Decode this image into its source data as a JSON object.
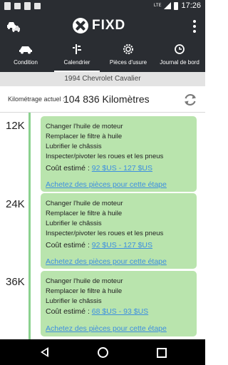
{
  "status_bar": {
    "network": "LTE",
    "time": "17:26"
  },
  "app": {
    "name": "FIXD"
  },
  "tabs": [
    {
      "label": "Condition",
      "icon": "car-icon"
    },
    {
      "label": "Calendrier",
      "icon": "wrench-icon"
    },
    {
      "label": "Pièces d'usure",
      "icon": "gear-icon"
    },
    {
      "label": "Journal de bord",
      "icon": "history-icon"
    }
  ],
  "vehicle": {
    "name": "1994 Chevrolet Cavalier"
  },
  "mileage": {
    "label": "Kilométrage actuel :",
    "value": "104 836 Kilomètres"
  },
  "schedule": [
    {
      "mileage": "12K",
      "tasks": [
        "Changer l'huile de moteur",
        "Remplacer le filtre à huile",
        "Lubrifier le châssis",
        "Inspecter/pivoter les roues et les pneus"
      ],
      "cost_label": "Coût estimé :",
      "cost": "92 $US - 127 $US",
      "parts_link": "Achetez des pièces pour cette étape"
    },
    {
      "mileage": "24K",
      "tasks": [
        "Changer l'huile de moteur",
        "Remplacer le filtre à huile",
        "Lubrifier le châssis",
        "Inspecter/pivoter les roues et les pneus"
      ],
      "cost_label": "Coût estimé :",
      "cost": "92 $US - 127 $US",
      "parts_link": "Achetez des pièces pour cette étape"
    },
    {
      "mileage": "36K",
      "tasks": [
        "Changer l'huile de moteur",
        "Remplacer le filtre à huile",
        "Lubrifier le châssis"
      ],
      "cost_label": "Coût estimé :",
      "cost": "68 $US - 93 $US",
      "parts_link": "Achetez des pièces pour cette étape"
    }
  ]
}
